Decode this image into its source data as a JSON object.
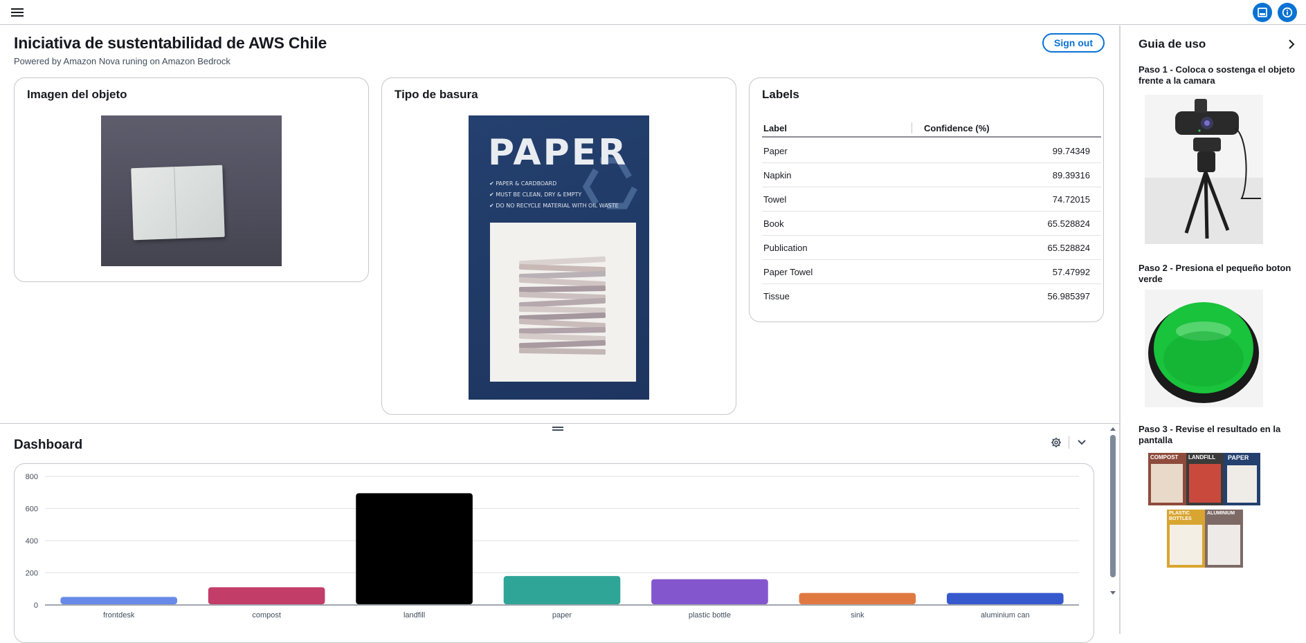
{
  "header": {
    "menu_icon": "hamburger-icon",
    "buttons": [
      {
        "icon": "panel-icon"
      },
      {
        "icon": "info-icon"
      }
    ]
  },
  "main": {
    "title": "Iniciativa de sustentabilidad de AWS Chile",
    "subtitle": "Powered by Amazon Nova runing on Amazon Bedrock",
    "signout_label": "Sign out"
  },
  "cards": {
    "object": {
      "title": "Imagen del objeto"
    },
    "waste": {
      "title": "Tipo de basura",
      "poster_title": "PAPER",
      "poster_lines": [
        "✔ PAPER & CARDBOARD",
        "✔ MUST BE CLEAN, DRY & EMPTY",
        "✔ DO NO RECYCLE MATERIAL WITH OIL WASTE"
      ]
    },
    "labels": {
      "title": "Labels",
      "columns": [
        "Label",
        "Confidence (%)"
      ],
      "rows": [
        {
          "label": "Paper",
          "confidence": "99.74349"
        },
        {
          "label": "Napkin",
          "confidence": "89.39316"
        },
        {
          "label": "Towel",
          "confidence": "74.72015"
        },
        {
          "label": "Book",
          "confidence": "65.528824"
        },
        {
          "label": "Publication",
          "confidence": "65.528824"
        },
        {
          "label": "Paper Towel",
          "confidence": "57.47992"
        },
        {
          "label": "Tissue",
          "confidence": "56.985397"
        }
      ]
    }
  },
  "guide": {
    "title": "Guia de uso",
    "steps": [
      {
        "text": "Paso 1 - Coloca o sostenga el objeto frente a la camara"
      },
      {
        "text": "Paso 2 - Presiona el pequeño boton verde"
      },
      {
        "text": "Paso 3 - Revise el resultado en la pantalla"
      }
    ],
    "poster_labels": [
      "COMPOST",
      "LANDFILL",
      "PAPER",
      "PLASTIC BOTTLES",
      "ALUMINIUM"
    ]
  },
  "dashboard": {
    "title": "Dashboard"
  },
  "chart_data": {
    "type": "bar",
    "categories": [
      "frontdesk",
      "compost",
      "landfill",
      "paper",
      "plastic bottle",
      "sink",
      "aluminium can"
    ],
    "values": [
      50,
      110,
      695,
      180,
      160,
      75,
      75
    ],
    "colors": [
      "#688ae8",
      "#c33d69",
      "#000000",
      "#2ea597",
      "#8456ce",
      "#e07941",
      "#3759ce"
    ],
    "yticks": [
      0,
      200,
      400,
      600,
      800
    ],
    "ylim": [
      0,
      800
    ],
    "grid": true,
    "title": "",
    "xlabel": "",
    "ylabel": ""
  }
}
